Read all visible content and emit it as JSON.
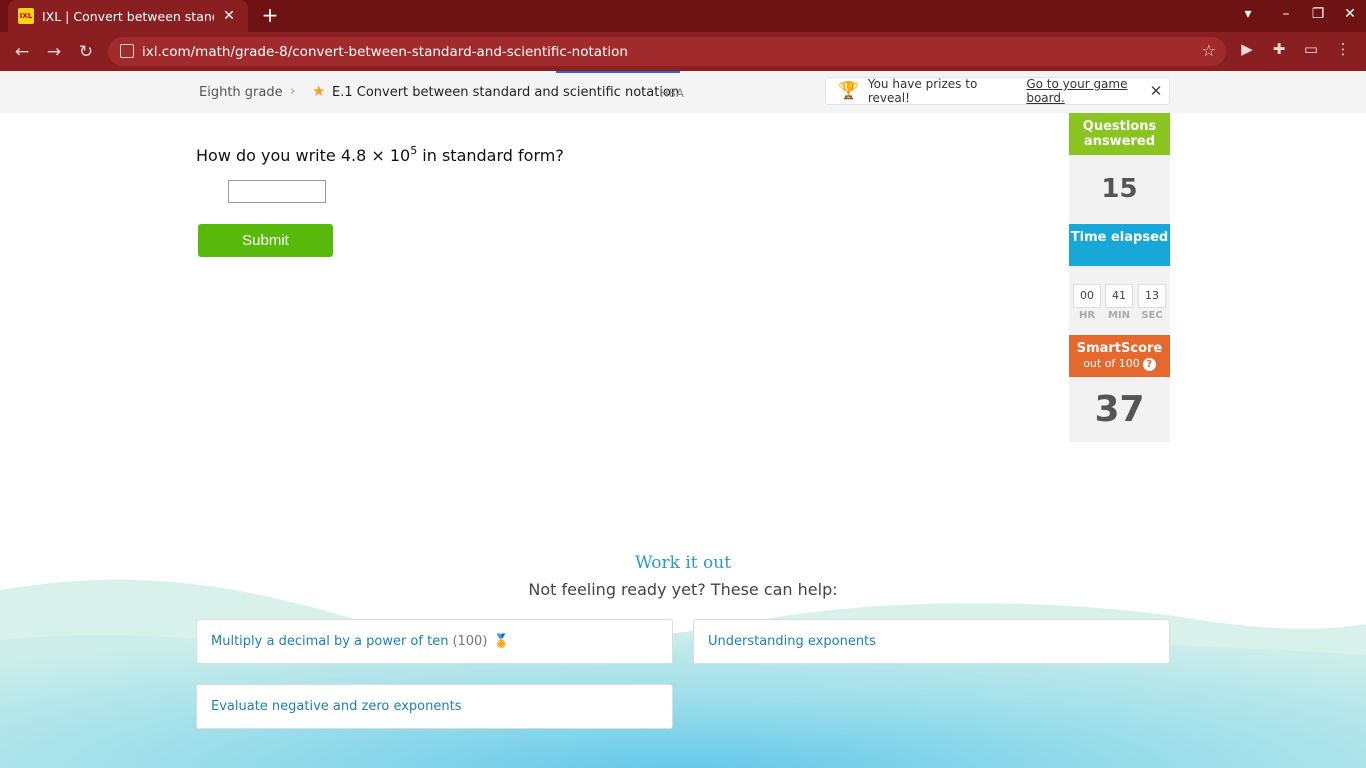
{
  "browser": {
    "tab_title": "IXL | Convert between standard and scientific notation",
    "tab_close": "✕",
    "new_tab": "+",
    "url": "ixl.com/math/grade-8/convert-between-standard-and-scientific-notation"
  },
  "breadcrumb": {
    "grade": "Eighth grade",
    "separator": "›",
    "skill": "E.1 Convert between standard and scientific notation",
    "code": "H8A"
  },
  "prize_banner": {
    "text": "You have prizes to reveal!",
    "link": "Go to your game board.",
    "close": "✕"
  },
  "question": {
    "prefix": "How do you write 4.8 × 10",
    "exponent": "5",
    "suffix": " in standard form?",
    "answer_value": ""
  },
  "submit_label": "Submit",
  "stats": {
    "questions_answered_label": "Questions answered",
    "questions_answered": "15",
    "time_label": "Time elapsed",
    "hours": "00",
    "minutes": "41",
    "seconds": "13",
    "hr_label": "HR",
    "min_label": "MIN",
    "sec_label": "SEC",
    "smartscore_label": "SmartScore",
    "smartscore_sub": "out of 100",
    "help": "?",
    "smartscore": "37"
  },
  "work_it_out": {
    "title": "Work it out",
    "subtitle": "Not feeling ready yet? These can help:",
    "links": [
      {
        "label": "Multiply a decimal by a power of ten",
        "score": "(100)"
      },
      {
        "label": "Understanding exponents"
      },
      {
        "label": "Evaluate negative and zero exponents"
      }
    ]
  },
  "colors": {
    "chrome": "#8a1f21",
    "submit": "#57b90a",
    "questions_answered": "#8ac420",
    "time_elapsed": "#18a8d8",
    "smartscore": "#e5682e",
    "link": "#1e7fb6"
  }
}
